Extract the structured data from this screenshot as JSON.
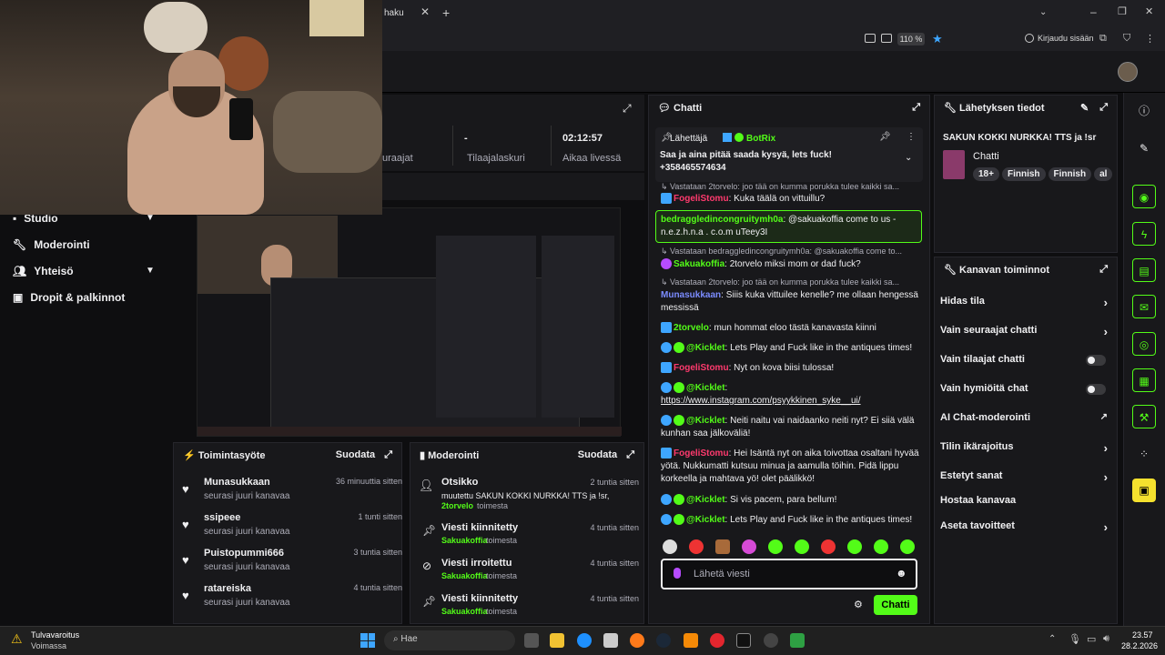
{
  "browser": {
    "tab_label": "haku",
    "tab_close": "✕",
    "new_tab": "+",
    "zoom": "110 %",
    "login_label": "Kirjaudu sisään"
  },
  "stats": {
    "items": [
      {
        "value": "",
        "label": "uraajat"
      },
      {
        "value": "-",
        "label": "Tilaajalaskuri"
      },
      {
        "value": "02:12:57",
        "label": "Aikaa livessä"
      }
    ]
  },
  "nav": {
    "items": [
      {
        "label": "Studio",
        "icon": "studio-icon",
        "chevron": true
      },
      {
        "label": "Moderointi",
        "icon": "wrench-icon",
        "chevron": false
      },
      {
        "label": "Yhteisö",
        "icon": "people-icon",
        "chevron": true
      },
      {
        "label": "Dropit & palkinnot",
        "icon": "gift-icon",
        "chevron": false
      }
    ]
  },
  "activity": {
    "title": "Toimintasyöte",
    "filter": "Suodata",
    "rows": [
      {
        "name": "Munasukkaan",
        "sub": "seurasi juuri kanavaa",
        "time": "36 minuuttia sitten"
      },
      {
        "name": "ssipeee",
        "sub": "seurasi juuri kanavaa",
        "time": "1 tunti sitten"
      },
      {
        "name": "Puistopummi666",
        "sub": "seurasi juuri kanavaa",
        "time": "3 tuntia sitten"
      },
      {
        "name": "ratareiska",
        "sub": "seurasi juuri kanavaa",
        "time": "4 tuntia sitten"
      }
    ]
  },
  "moderation": {
    "title": "Moderointi",
    "filter": "Suodata",
    "rows": [
      {
        "title": "Otsikko",
        "line1": "muutettu SAKUN KOKKI NURKKA! TTS ja !sr,",
        "user": "2torvelo",
        "action": "toimesta",
        "time": "2 tuntia sitten"
      },
      {
        "title": "Viesti kiinnitetty",
        "line1": "",
        "user": "Sakuakoffia",
        "action": "toimesta",
        "time": "4 tuntia sitten"
      },
      {
        "title": "Viesti irroitettu",
        "line1": "",
        "user": "Sakuakoffia",
        "action": "toimesta",
        "time": "4 tuntia sitten"
      },
      {
        "title": "Viesti kiinnitetty",
        "line1": "",
        "user": "Sakuakoffia",
        "action": "toimesta",
        "time": "4 tuntia sitten"
      }
    ]
  },
  "chat": {
    "title": "Chatti",
    "pinned": {
      "sender_label": "Lähettäjä",
      "sender": "BotRix",
      "text": "Saa ja aina pitää saada kysyä, lets fuck! +358465574634"
    },
    "messages": [
      {
        "kind": "reply",
        "text": "Vastataan 2torvelo: joo tää on kumma porukka tulee kaikki sa..."
      },
      {
        "kind": "msg",
        "user": "FogeliStomu",
        "color": "#ff3a6e",
        "text": "Kuka täälä on vittuillu?"
      },
      {
        "kind": "msg",
        "user": "bedraggledincongruitymh0a",
        "color": "#53fc18",
        "text": "@sakuakoffia come to us - n.e.z.h.n.a . c.o.m uTeey3I",
        "highlight": true
      },
      {
        "kind": "reply",
        "text": "Vastataan bedraggledincongruitymh0a: @sakuakoffia come to..."
      },
      {
        "kind": "msg",
        "user": "Sakuakoffia",
        "color": "#53fc18",
        "text": "2torvelo miksi mom or dad fuck?"
      },
      {
        "kind": "reply",
        "text": "Vastataan 2torvelo: joo tää on kumma porukka tulee kaikki sa..."
      },
      {
        "kind": "msg",
        "user": "Munasukkaan",
        "color": "#7b8cff",
        "text": "Siiis kuka vittuilee kenelle? me ollaan hengessä messissä"
      },
      {
        "kind": "msg",
        "user": "2torvelo",
        "color": "#53fc18",
        "text": "mun hommat eloo tästä kanavasta kiinni"
      },
      {
        "kind": "msg",
        "user": "@Kicklet",
        "color": "#53fc18",
        "text": "Lets Play and Fuck like in the antiques times!"
      },
      {
        "kind": "msg",
        "user": "FogeliStomu",
        "color": "#ff3a6e",
        "text": "Nyt on kova biisi tulossa!"
      },
      {
        "kind": "msg",
        "user": "@Kicklet",
        "color": "#53fc18",
        "text": "https://www.instagram.com/psyykkinen_syke__ui/"
      },
      {
        "kind": "msg",
        "user": "@Kicklet",
        "color": "#53fc18",
        "text": "Neiti naitu vai naidaanko neiti nyt? Ei siiä välä kunhan saa jälkoväliä!"
      },
      {
        "kind": "msg",
        "user": "FogeliStomu",
        "color": "#ff3a6e",
        "text": "Hei Isäntä nyt on aika toivottaa osaltani hyvää yötä. Nukkumatti kutsuu minua ja aamulla töihin. Pidä lippu korkeella ja mahtava yö! olet päälikkö!"
      },
      {
        "kind": "msg",
        "user": "@Kicklet",
        "color": "#53fc18",
        "text": "Si vis pacem, para bellum!"
      },
      {
        "kind": "msg",
        "user": "@Kicklet",
        "color": "#53fc18",
        "text": "Lets Play and Fuck like in the antiques times!"
      }
    ],
    "input_placeholder": "Lähetä viesti",
    "send_label": "Chatti"
  },
  "stream_info": {
    "title": "Lähetyksen tiedot",
    "stream_title": "SAKUN KOKKI NURKKA! TTS ja !sr",
    "category": "Chatti",
    "tags": [
      "18+",
      "Finnish",
      "Finnish",
      "al"
    ]
  },
  "channel_actions": {
    "title": "Kanavan toiminnot",
    "rows": [
      {
        "label": "Hidas tila",
        "control": "chevron"
      },
      {
        "label": "Vain seuraajat chatti",
        "control": "chevron"
      },
      {
        "label": "Vain tilaajat chatti",
        "control": "toggle"
      },
      {
        "label": "Vain hymiöitä chat",
        "control": "toggle"
      },
      {
        "label": "AI Chat-moderointi",
        "control": "external"
      },
      {
        "label": "Tilin ikärajoitus",
        "control": "chevron"
      },
      {
        "label": "Estetyt sanat",
        "control": "chevron"
      },
      {
        "label": "Hostaa kanavaa",
        "control": "none"
      },
      {
        "label": "Aseta tavoitteet",
        "control": "chevron"
      }
    ]
  },
  "taskbar": {
    "warning_title": "Tulvavaroitus",
    "warning_sub": "Voimassa",
    "search": "Hae",
    "time": "23.57",
    "date": "28.2.2026"
  }
}
